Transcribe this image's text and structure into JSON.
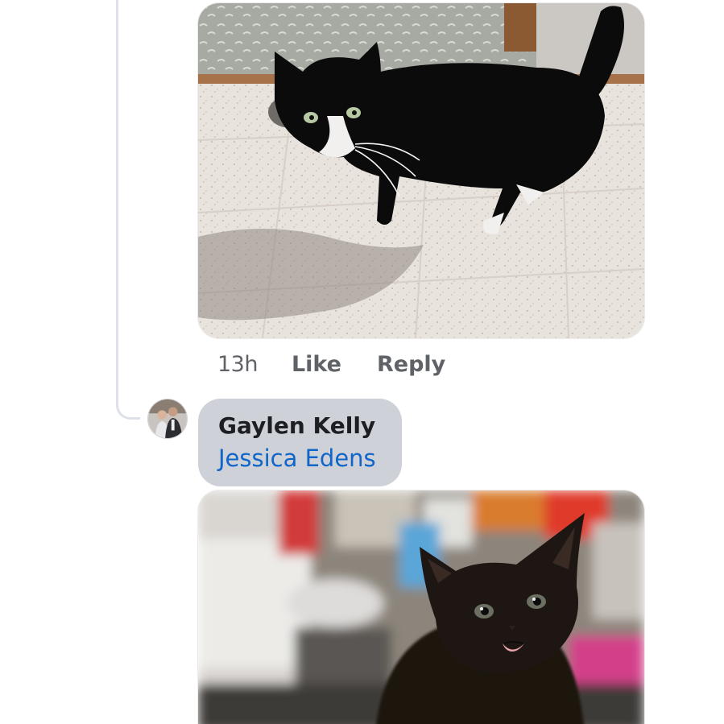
{
  "comment_1": {
    "photo_alt": "black and white cat",
    "actions": {
      "time": "13h",
      "like": "Like",
      "reply": "Reply"
    }
  },
  "comment_2": {
    "author": "Gaylen Kelly",
    "mention": "Jessica Edens",
    "avatar_icon": "profile-photo",
    "photo_alt": "black kitten"
  },
  "colors": {
    "bubble": "#ced1d8",
    "mention_link": "#1065c9",
    "action_text": "#5f6266",
    "thread_line": "#dfe1ea"
  }
}
